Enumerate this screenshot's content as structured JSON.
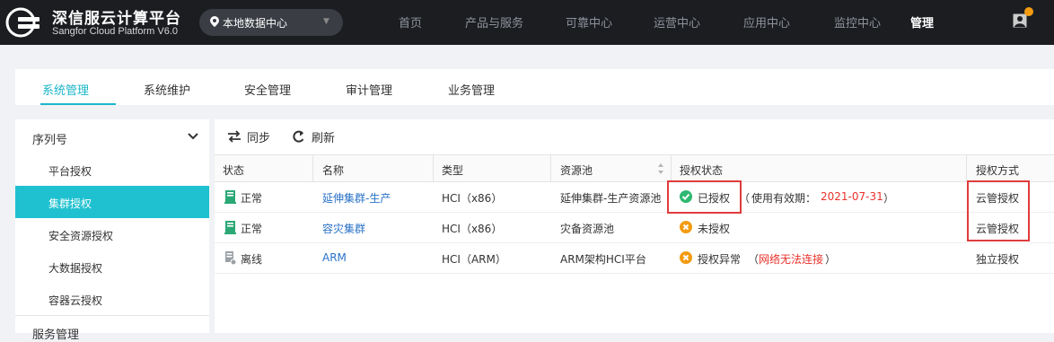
{
  "header": {
    "brand_cn": "深信服云计算平台",
    "brand_en": "Sangfor Cloud Platform V6.0",
    "datacenter": "本地数据中心",
    "nav": [
      "首页",
      "产品与服务",
      "可靠中心",
      "运营中心",
      "应用中心",
      "监控中心",
      "管理"
    ],
    "active_nav": "管理"
  },
  "tabs": [
    "系统管理",
    "系统维护",
    "安全管理",
    "审计管理",
    "业务管理"
  ],
  "sidebar": {
    "section": "序列号",
    "items": [
      "平台授权",
      "集群授权",
      "安全资源授权",
      "大数据授权",
      "容器云授权"
    ],
    "active_item": "集群授权",
    "next_section": "服务管理"
  },
  "toolbar": {
    "sync": "同步",
    "refresh": "刷新"
  },
  "table": {
    "headers": [
      "状态",
      "名称",
      "类型",
      "资源池",
      "授权状态",
      "授权方式"
    ],
    "rows": [
      {
        "status": "正常",
        "name": "延伸集群-生产",
        "type": "HCI（x86）",
        "pool": "延伸集群-生产资源池",
        "auth_state": "已授权",
        "auth_note_open": "（",
        "auth_note_label": "使用有效期：",
        "auth_note_value": "2021-07-31",
        "auth_note_close": "）",
        "auth_method": "云管授权"
      },
      {
        "status": "正常",
        "name": "容灾集群",
        "type": "HCI（x86）",
        "pool": "灾备资源池",
        "auth_state": "未授权",
        "auth_method": "云管授权"
      },
      {
        "status": "离线",
        "name": "ARM",
        "type": "HCI（ARM）",
        "pool": "ARM架构HCI平台",
        "auth_state": "授权异常",
        "auth_note_open": "（",
        "auth_note_value": "网络无法连接",
        "auth_note_close": "）",
        "auth_method": "独立授权"
      }
    ]
  },
  "colors": {
    "accent": "#1bb6c9",
    "ok": "#2eb872",
    "warn": "#f39c12",
    "error": "#e8322b",
    "link": "#2a72c7",
    "highlight_box": "#e03c3c"
  },
  "icons": [
    "logo-icon",
    "location-pin-icon",
    "chevron-down-icon",
    "user-icon",
    "sync-icon",
    "refresh-icon",
    "server-icon",
    "server-offline-icon",
    "check-circle-icon",
    "close-circle-icon",
    "sort-icon"
  ]
}
